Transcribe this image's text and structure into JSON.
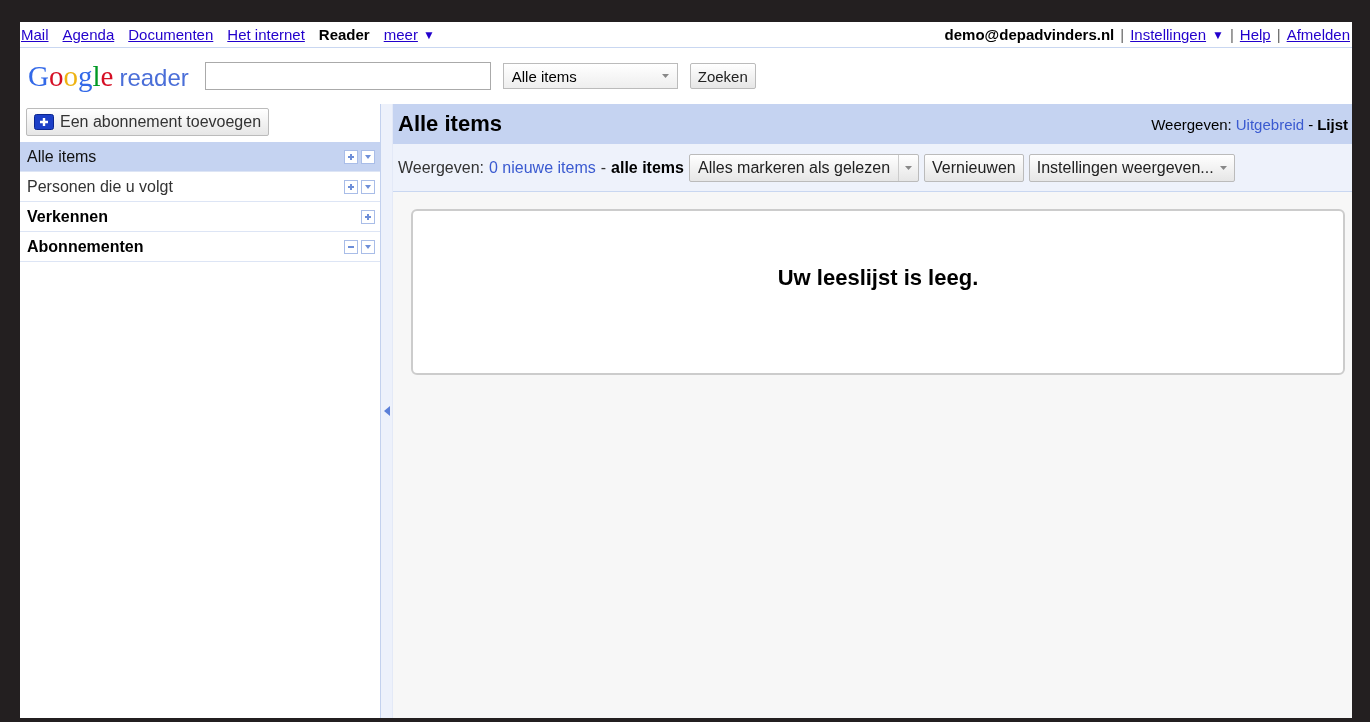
{
  "top_bar": {
    "apps": [
      {
        "label": "Mail",
        "selected": false
      },
      {
        "label": "Agenda",
        "selected": false
      },
      {
        "label": "Documenten",
        "selected": false
      },
      {
        "label": "Het internet",
        "selected": false
      },
      {
        "label": "Reader",
        "selected": true
      }
    ],
    "more": {
      "label": "meer",
      "caret": "▼"
    },
    "account": {
      "email": "demo@depadvinders.nl",
      "links": [
        {
          "label": "Instellingen",
          "caret": "▼"
        },
        {
          "label": "Help"
        },
        {
          "label": "Afmelden"
        }
      ],
      "separator": "|"
    }
  },
  "header": {
    "logo": {
      "brand": "Google",
      "product": "reader"
    },
    "scope": "Alle items",
    "search_button": "Zoeken"
  },
  "sidebar": {
    "add_button": "Een abonnement toevoegen",
    "items": [
      {
        "label": "Alle items",
        "kind": "item",
        "selected": true,
        "actions": [
          {
            "kind": "add"
          },
          {
            "kind": "menu"
          }
        ]
      },
      {
        "label": "Personen die u volgt",
        "kind": "item",
        "selected": false,
        "actions": [
          {
            "kind": "add"
          },
          {
            "kind": "menu"
          }
        ]
      },
      {
        "label": "Verkennen",
        "kind": "section",
        "selected": false,
        "actions": [
          {
            "kind": "add"
          }
        ]
      },
      {
        "label": "Abonnementen",
        "kind": "section",
        "selected": false,
        "actions": [
          {
            "kind": "collapse"
          },
          {
            "kind": "menu"
          }
        ]
      }
    ]
  },
  "main": {
    "title": "Alle items",
    "view_label": "Weergeven:",
    "view_modes": [
      {
        "label": "Uitgebreid",
        "selected": false
      },
      {
        "label": "Lijst",
        "selected": true
      }
    ],
    "dash": "-",
    "toolbar": {
      "filter_label": "Weergeven:",
      "filters": [
        {
          "label": "0 nieuwe items",
          "selected": false
        },
        {
          "label": "alle items",
          "selected": true
        }
      ],
      "dash": "-",
      "buttons": [
        {
          "label": "Alles markeren als gelezen",
          "kind": "split"
        },
        {
          "label": "Vernieuwen",
          "kind": "plain"
        },
        {
          "label": "Instellingen weergeven...",
          "kind": "dropdown"
        }
      ]
    },
    "empty_message": "Uw leeslijst is leeg."
  }
}
